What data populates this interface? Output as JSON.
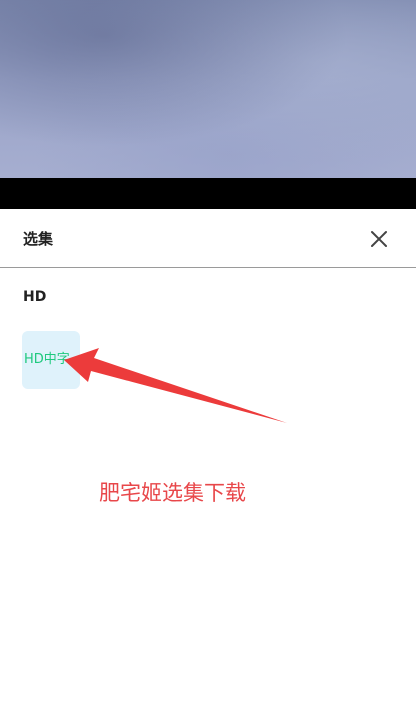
{
  "episode_sheet": {
    "title": "选集",
    "close_icon": "close-icon",
    "section_label": "HD",
    "episodes": [
      {
        "label": "HD中字",
        "selected": true
      }
    ]
  },
  "annotation": {
    "text": "肥宅姬选集下载",
    "color": "#e8474a",
    "arrow_icon": "red-arrow-icon"
  },
  "colors": {
    "episode_text": "#1fc97e",
    "episode_bg": "#dff2fb"
  }
}
